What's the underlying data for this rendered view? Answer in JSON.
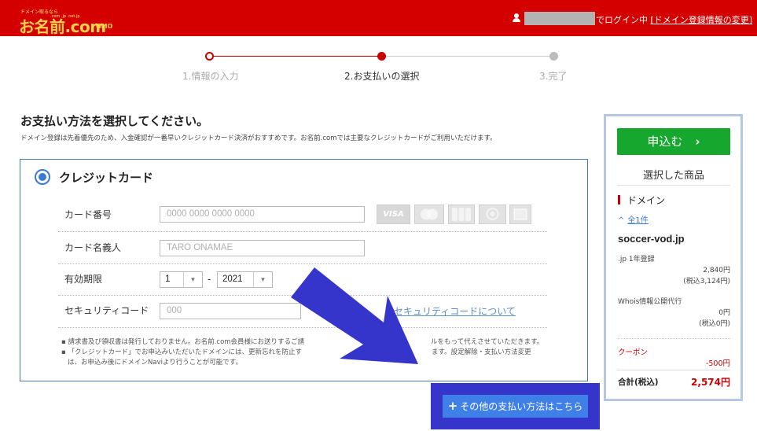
{
  "header": {
    "logo_tagline": "ドメイン取るなら",
    "logo_text": "お名前.com",
    "logo_badges": ".com .jp .net.jp",
    "logo_gmo": "GMO",
    "login_suffix": "でログイン中",
    "account_link": "[ドメイン登録情報の変更]"
  },
  "steps": [
    {
      "label": "1.情報の入力"
    },
    {
      "label": "2.お支払いの選択"
    },
    {
      "label": "3.完了"
    }
  ],
  "page": {
    "title": "お支払い方法を選択してください。",
    "description": "ドメイン登録は先着優先のため、入金確認が一番早いクレジットカード決済がおすすめです。お名前.comでは主要なクレジットカードがご利用いただけます。"
  },
  "credit_card": {
    "title": "クレジットカード",
    "card_number_label": "カード番号",
    "card_number_placeholder": "0000 0000 0000 0000",
    "card_holder_label": "カード名義人",
    "card_holder_placeholder": "TARO ONAMAE",
    "expiry_label": "有効期限",
    "expiry_month": "1",
    "expiry_separator": "-",
    "expiry_year": "2021",
    "security_label": "セキュリティコード",
    "security_placeholder": "000",
    "security_link": "セキュリティコードについて",
    "card_brands": [
      "VISA",
      "Mastercard",
      "JCB",
      "Diners Club",
      "American Express"
    ],
    "notes": [
      "請求書及び領収書は発行しておりません。お名前.com会員様にお送りするご請",
      "ルをもって代えさせていただきます。",
      "「クレジットカード」でお申込みいただいたドメインには、更新忘れを防止す",
      "ます。設定解除・支払い方法変更",
      "は、お申込み後にドメインNaviより行うことが可能です。"
    ]
  },
  "other_payment": {
    "icon": "+",
    "label": "その他の支払い方法はこちら"
  },
  "side_panel": {
    "apply_label": "申込む",
    "apply_chevron": "›",
    "selected_heading": "選択した商品",
    "category": "ドメイン",
    "toggle_caret": "^",
    "all_link": "全1件",
    "domain": "soccer-vod.jp",
    "plan": ".jp 1年登録",
    "plan_price": "2,840円",
    "plan_price_tax": "(税込3,124円)",
    "whois_label": "Whois情報公開代行",
    "whois_price": "0円",
    "whois_price_tax": "(税込0円)",
    "coupon_label": "クーポン",
    "coupon_value": "-500円",
    "total_label": "合計(税込)",
    "total_value": "2,574円"
  },
  "colors": {
    "brand_red": "#d40000",
    "progress_red": "#c80000",
    "accent_blue": "#3a7bd5",
    "apply_green": "#16a72e",
    "highlight_blue": "#3535cc"
  }
}
